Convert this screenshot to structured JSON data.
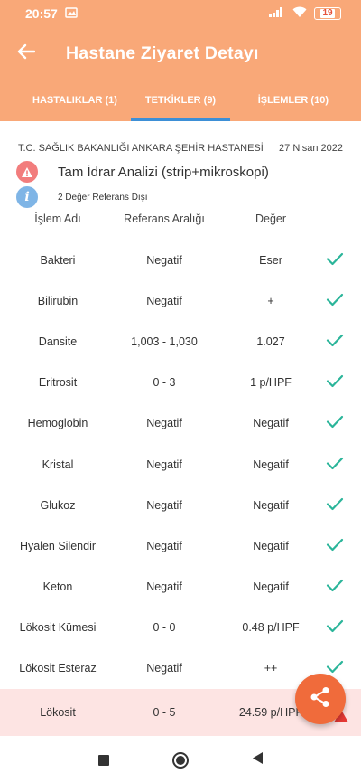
{
  "status_bar": {
    "time": "20:57",
    "battery": "19"
  },
  "app_bar": {
    "title": "Hastane Ziyaret Detayı"
  },
  "tabs": [
    {
      "label": "HASTALIKLAR (1)",
      "active": false
    },
    {
      "label": "TETKİKLER (9)",
      "active": true
    },
    {
      "label": "İŞLEMLER (10)",
      "active": false
    }
  ],
  "visit": {
    "hospital": "T.C. SAĞLIK BAKANLIĞI ANKARA ŞEHİR HASTANESİ",
    "date": "27 Nisan 2022",
    "test_title": "Tam İdrar Analizi (strip+mikroskopi)",
    "info": "2 Değer Referans Dışı"
  },
  "table": {
    "headers": [
      "İşlem Adı",
      "Referans Aralığı",
      "Değer"
    ],
    "rows": [
      {
        "name": "Bakteri",
        "ref": "Negatif",
        "value": "Eser"
      },
      {
        "name": "Bilirubin",
        "ref": "Negatif",
        "value": "+"
      },
      {
        "name": "Dansite",
        "ref": "1,003 - 1,030",
        "value": "1.027"
      },
      {
        "name": "Eritrosit",
        "ref": "0 - 3",
        "value": "1 p/HPF"
      },
      {
        "name": "Hemoglobin",
        "ref": "Negatif",
        "value": "Negatif"
      },
      {
        "name": "Kristal",
        "ref": "Negatif",
        "value": "Negatif"
      },
      {
        "name": "Glukoz",
        "ref": "Negatif",
        "value": "Negatif"
      },
      {
        "name": "Hyalen Silendir",
        "ref": "Negatif",
        "value": "Negatif"
      },
      {
        "name": "Keton",
        "ref": "Negatif",
        "value": "Negatif"
      },
      {
        "name": "Lökosit Kümesi",
        "ref": "0 - 0",
        "value": "0.48 p/HPF"
      },
      {
        "name": "Lökosit Esteraz",
        "ref": "Negatif",
        "value": "++"
      },
      {
        "name": "Lökosit",
        "ref": "0 - 5",
        "value": "24.59 p/HPF"
      }
    ]
  },
  "colors": {
    "accent": "#f9a878",
    "check": "#2bb59a",
    "fab": "#f06b3b",
    "highlight_row": "#fde4e3",
    "tab_indicator": "#3d8fd6"
  },
  "icons": [
    "back-arrow-icon",
    "warning-icon",
    "info-icon",
    "check-icon",
    "share-icon"
  ]
}
